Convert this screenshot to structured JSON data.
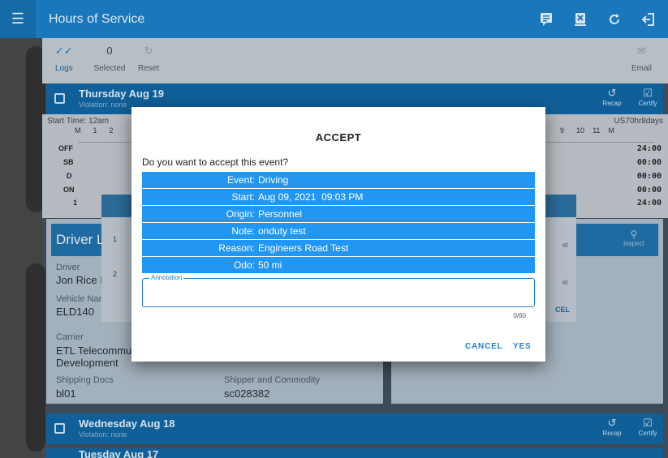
{
  "app": {
    "title": "Hours of Service",
    "actions": [
      "chat-icon",
      "transfer-icon",
      "refresh-icon",
      "logout-icon"
    ]
  },
  "toolbar": {
    "logs_label": "Logs",
    "selected_count": "0",
    "selected_label": "Selected",
    "reset_label": "Reset",
    "email_label": "Email"
  },
  "days": [
    {
      "title": "Thursday Aug 19",
      "violation": "Violation: none",
      "recap": "Recap",
      "certify": "Certify"
    },
    {
      "title": "Wednesday Aug 18",
      "violation": "Violation: none",
      "recap": "Recap",
      "certify": "Certify"
    },
    {
      "title": "Tuesday Aug 17"
    }
  ],
  "graph": {
    "start_time": "Start Time: 12am",
    "ruleset": "US70hr8days",
    "hour_labels_left": [
      "M",
      "1",
      "2"
    ],
    "hour_labels_right": [
      "9",
      "10",
      "11",
      "M"
    ],
    "rows": [
      "OFF",
      "SB",
      "D",
      "ON"
    ],
    "totals": [
      "24:00",
      "00:00",
      "00:00",
      "00:00"
    ],
    "total": "24:00",
    "extra_left": "1"
  },
  "driver_panel": {
    "title": "Driver L",
    "driver_label": "Driver",
    "driver_value": "Jon Rice II",
    "vehicle_label": "Vehicle Nan",
    "vehicle_value": "ELD140",
    "carrier_label": "Carrier",
    "carrier_value_1": "ETL Telecommur",
    "carrier_value_2": "Development",
    "shipping_label": "Shipping Docs",
    "shipping_value": "bl01",
    "shipper_label": "Shipper and Commodity",
    "shipper_value": "sc028382",
    "under_numbers": [
      "1",
      "2"
    ]
  },
  "right_panel": {
    "inspect_label": "Inspect",
    "frag_cel": "CEL",
    "frag_et": "et"
  },
  "dialog": {
    "title": "ACCEPT",
    "question": "Do you want to accept this event?",
    "rows": [
      {
        "key": "Event:",
        "value": "Driving"
      },
      {
        "key": "Start:",
        "value": "Aug 09, 2021  09:03 PM"
      },
      {
        "key": "Origin:",
        "value": "Personnel"
      },
      {
        "key": "Note:",
        "value": "onduty test"
      },
      {
        "key": "Reason:",
        "value": "Engineers Road Test"
      },
      {
        "key": "Odo:",
        "value": "50 mi"
      }
    ],
    "annotation_label": "Annotation",
    "annotation_value": "",
    "char_count": "0/60",
    "cancel_label": "CANCEL",
    "yes_label": "YES"
  },
  "colors": {
    "appbar": "#1a77bb",
    "day_bar": "#115f98",
    "accent": "#2196f3",
    "button_text": "#1f7fd0"
  }
}
